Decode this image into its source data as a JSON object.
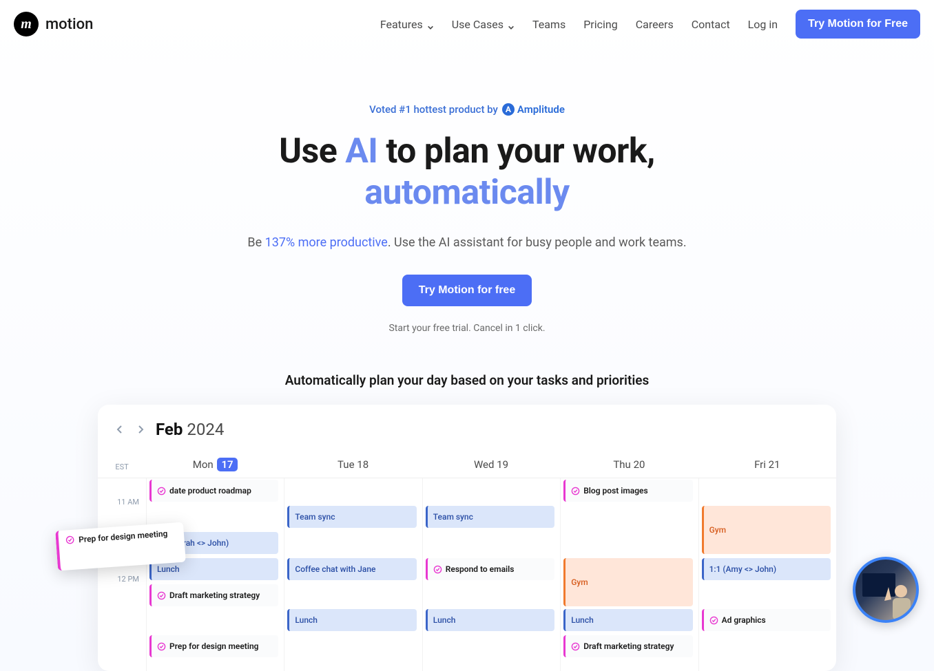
{
  "header": {
    "brand": "motion",
    "nav": {
      "features": "Features",
      "use_cases": "Use Cases",
      "teams": "Teams",
      "pricing": "Pricing",
      "careers": "Careers",
      "contact": "Contact",
      "login": "Log in",
      "try_free": "Try Motion for Free"
    }
  },
  "hero": {
    "voted_prefix": "Voted #1 hottest product by",
    "amplitude": "Amplitude",
    "title_1": "Use ",
    "title_ai": "AI",
    "title_2": " to plan your work,",
    "title_3": "automatically",
    "sub_prefix": "Be ",
    "sub_link": "137% more productive",
    "sub_suffix": ". Use the AI assistant for busy people and work teams.",
    "cta": "Try Motion for free",
    "note": "Start your free trial. Cancel in 1 click."
  },
  "section_heading": "Automatically plan your day based on your tasks and priorities",
  "calendar": {
    "month": "Feb",
    "year": "2024",
    "tz": "EST",
    "days": [
      {
        "label": "Mon",
        "num": "17",
        "active": true
      },
      {
        "label": "Tue",
        "num": "18",
        "active": false
      },
      {
        "label": "Wed",
        "num": "19",
        "active": false
      },
      {
        "label": "Thu",
        "num": "20",
        "active": false
      },
      {
        "label": "Fri",
        "num": "21",
        "active": false
      }
    ],
    "times": {
      "t11": "11 AM",
      "t12": "12 PM"
    },
    "floating": "Prep for design meeting",
    "events": {
      "mon_roadmap": "date product roadmap",
      "mon_11": "1:1 (Sarah <> John)",
      "mon_lunch": "Lunch",
      "mon_draft": "Draft marketing strategy",
      "mon_prep": "Prep for design meeting",
      "tue_sync": "Team sync",
      "tue_coffee": "Coffee chat with Jane",
      "tue_lunch": "Lunch",
      "wed_sync": "Team sync",
      "wed_emails": "Respond to emails",
      "wed_lunch": "Lunch",
      "thu_blog": "Blog post images",
      "thu_gym": "Gym",
      "thu_lunch": "Lunch",
      "thu_draft": "Draft marketing strategy",
      "fri_gym": "Gym",
      "fri_11": "1:1 (Amy <> John)",
      "fri_ad": "Ad graphics"
    }
  }
}
